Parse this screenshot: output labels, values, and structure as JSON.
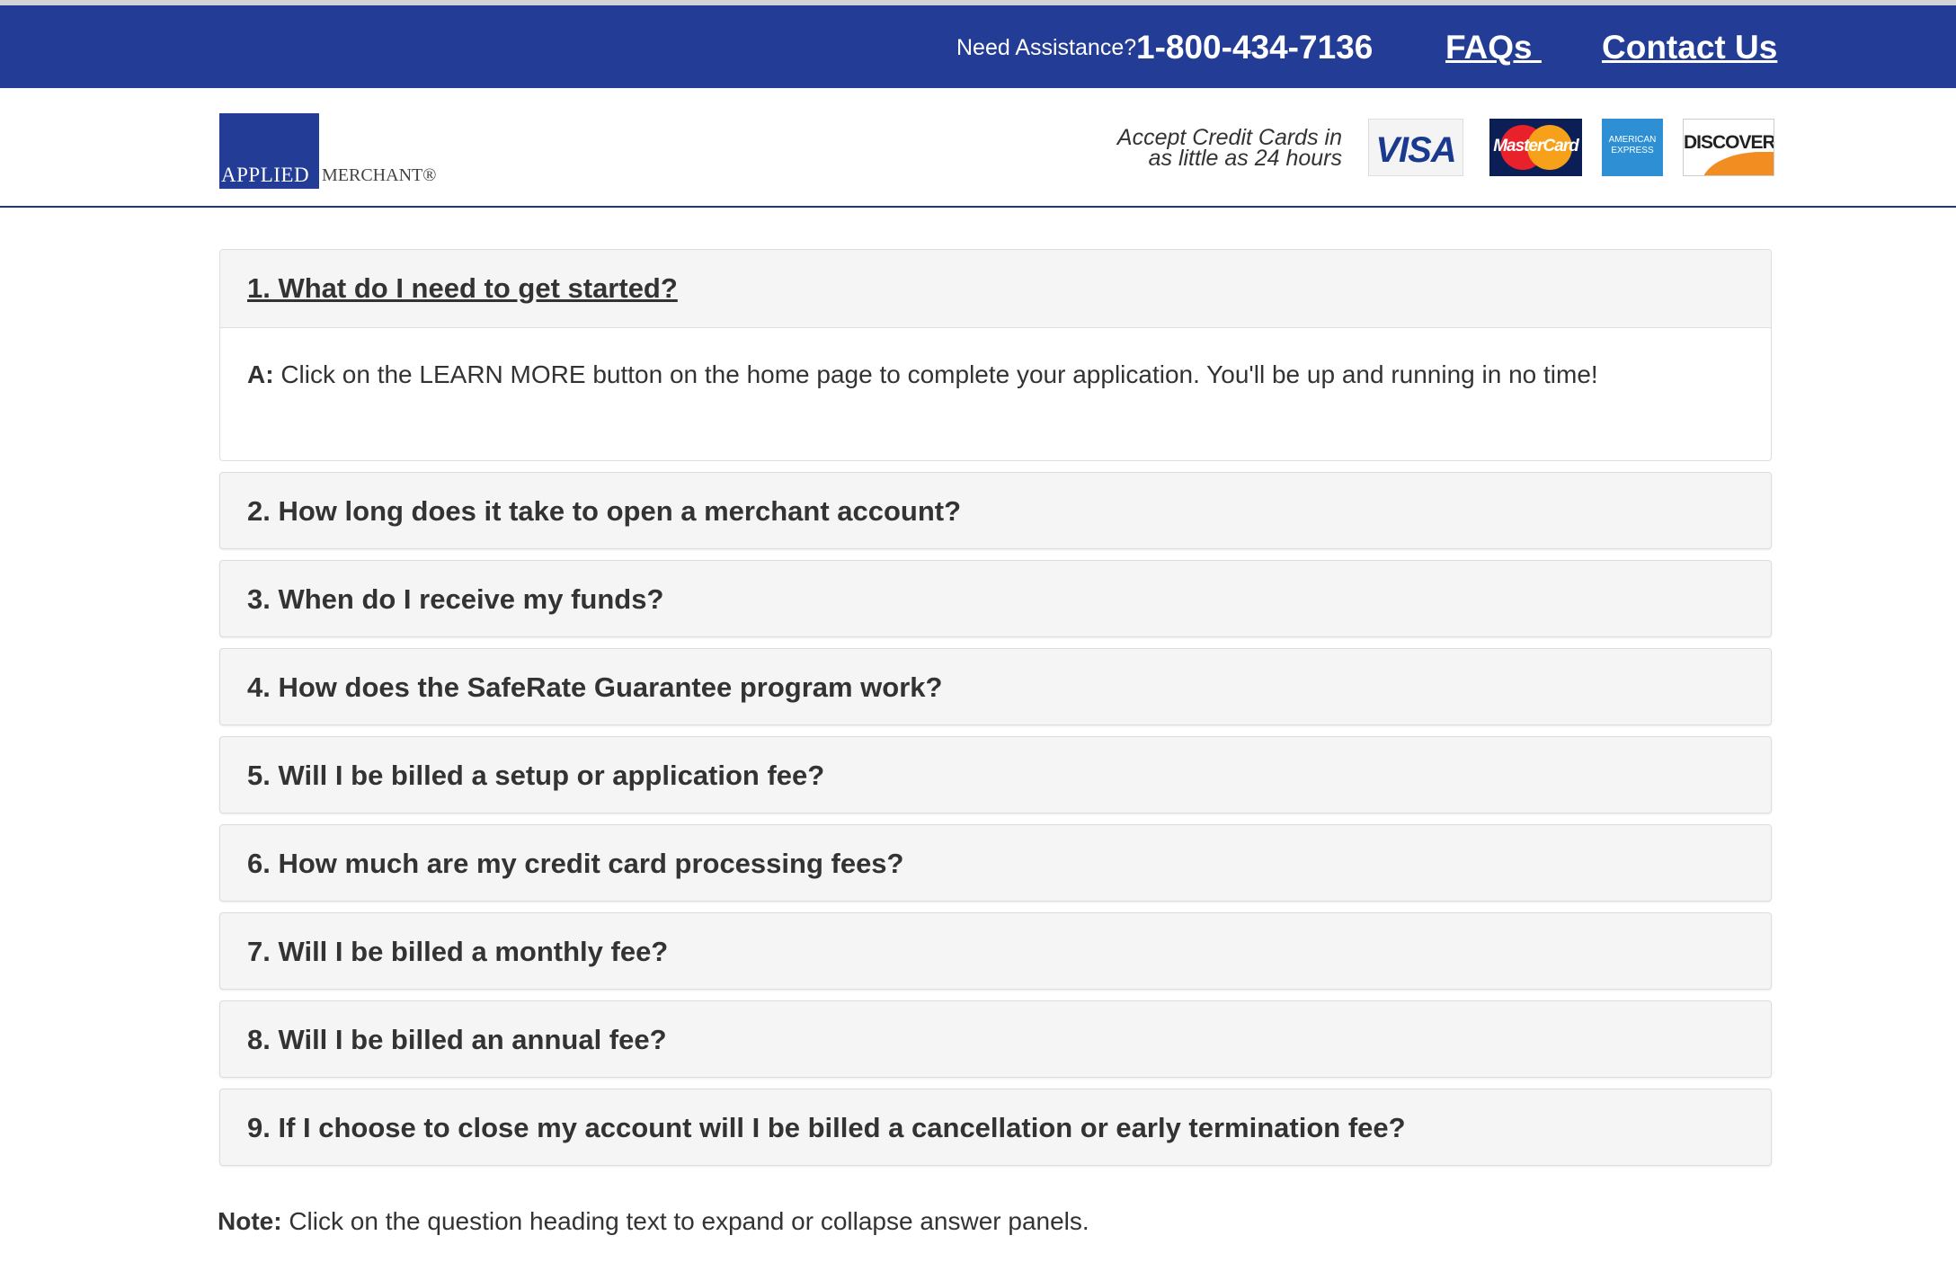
{
  "topbar": {
    "assist_label": "Need Assistance?",
    "phone": "1-800-434-7136",
    "faqs_label": "FAQs ",
    "contact_label": "Contact Us",
    "bg_color": "#233d96"
  },
  "header": {
    "logo_word1": "APPLIED",
    "logo_word2": "MERCHANT®",
    "accept_line1": "Accept Credit Cards in",
    "accept_line2": "as little as 24 hours",
    "cards": {
      "visa": "VISA",
      "mastercard": "MasterCard",
      "amex_line1": "AMERICAN",
      "amex_line2": "EXPRESS",
      "discover": "DISCOVER"
    }
  },
  "faq": {
    "open": {
      "question": "1. What do I need to get started?",
      "answer_label": "A:",
      "answer_text": "Click on the LEARN MORE button on the home page to complete your application. You'll be up and running in no time!"
    },
    "collapsed": [
      "2. How long does it take to open a merchant account?",
      "3. When do I receive my funds?",
      "4. How does the SafeRate Guarantee program work?",
      "5. Will I be billed a setup or application fee?",
      "6. How much are my credit card processing fees?",
      "7. Will I be billed a monthly fee?",
      "8. Will I be billed an annual fee?",
      "9. If I choose to close my account will I be billed a cancellation or early termination fee?"
    ]
  },
  "note": {
    "label": "Note:",
    "text": "Click on the question heading text to expand or collapse answer panels."
  }
}
